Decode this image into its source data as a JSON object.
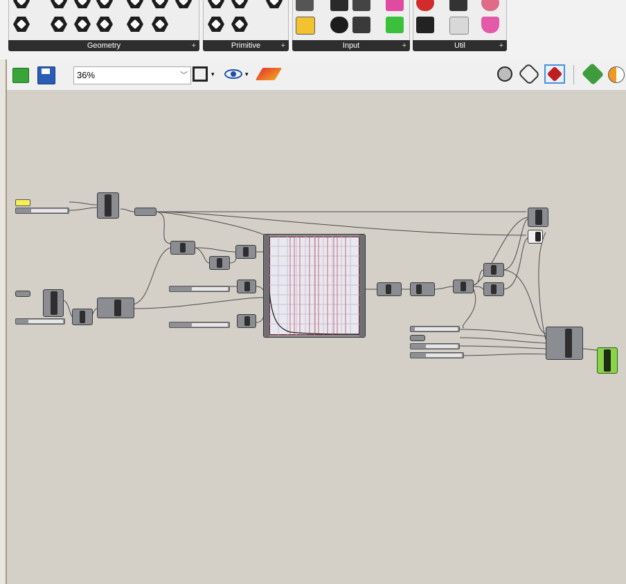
{
  "ribbon": {
    "panels": [
      {
        "label": "Geometry"
      },
      {
        "label": "Primitive"
      },
      {
        "label": "Input"
      },
      {
        "label": "Util"
      }
    ]
  },
  "toolbar": {
    "zoom_value": "36%"
  },
  "icons": [
    "open-file-icon",
    "save-icon",
    "zoom-extents-icon",
    "preview-eye-icon",
    "sketch-pen-icon",
    "preview-wireframe-icon",
    "preview-shaded-icon",
    "preview-selected-icon",
    "bake-icon",
    "preview-mesh-icon"
  ],
  "colors": {
    "canvas": "#d4d0c8",
    "component": "#8c8d92",
    "toggle": "#f5ef55",
    "output_component": "#8bd34a"
  }
}
